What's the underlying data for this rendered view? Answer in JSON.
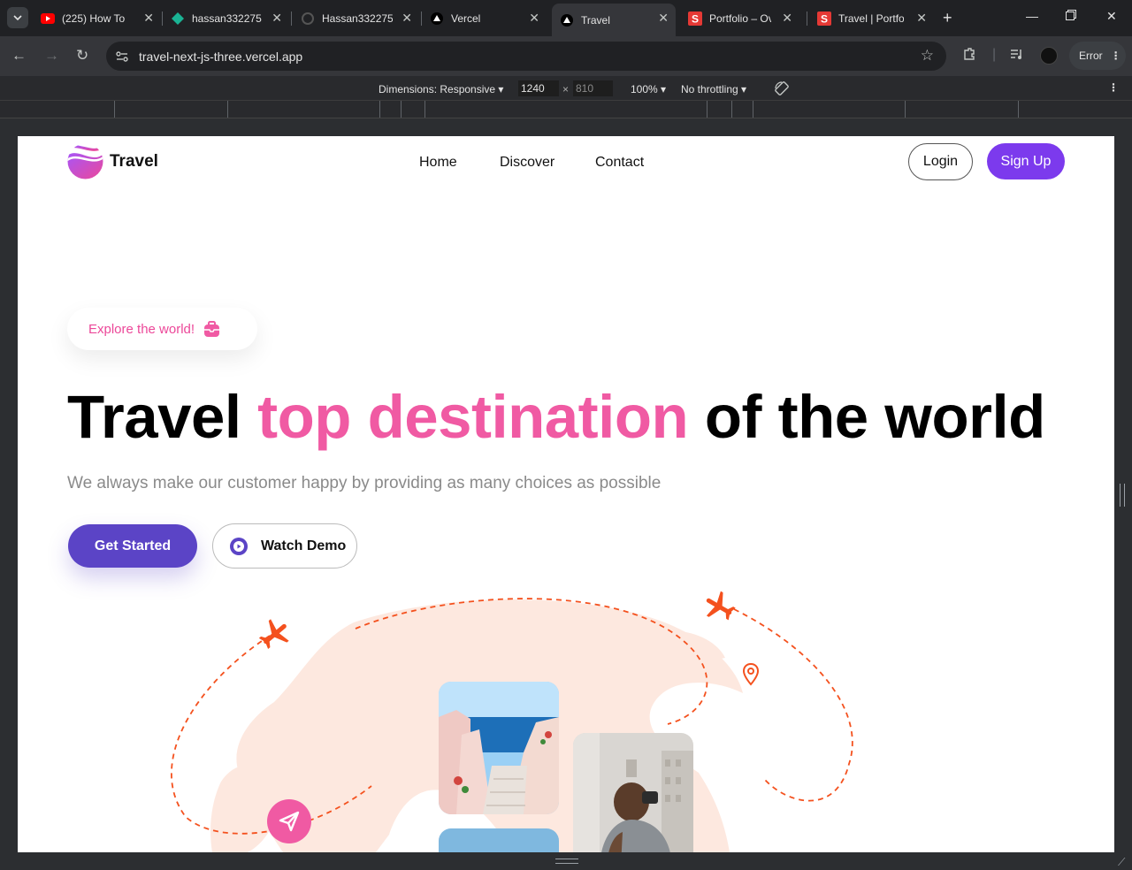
{
  "browser": {
    "tabs": [
      {
        "label": "(225) How To",
        "icon": "youtube-icon",
        "color": "#ff0000"
      },
      {
        "label": "hassan332275",
        "icon": "diamond-icon",
        "color": "#1ab394"
      },
      {
        "label": "Hassan332275",
        "icon": "github-icon",
        "color": "#555555"
      },
      {
        "label": "Vercel",
        "icon": "vercel-icon",
        "color": "#ffffff"
      },
      {
        "label": "Travel",
        "icon": "vercel-icon",
        "color": "#ffffff",
        "active": true
      },
      {
        "label": "Portfolio – Ov",
        "icon": "s-icon",
        "color": "#e53935"
      },
      {
        "label": "Travel | Portfo",
        "icon": "s-icon",
        "color": "#e53935"
      }
    ],
    "url": "travel-next-js-three.vercel.app",
    "profile_status": "Error",
    "devtools": {
      "dimensions_label": "Dimensions: Responsive",
      "width": "1240",
      "height": "810",
      "zoom": "100%",
      "throttling": "No throttling"
    }
  },
  "page": {
    "brand": "Travel",
    "nav": [
      "Home",
      "Discover",
      "Contact"
    ],
    "login_label": "Login",
    "signup_label": "Sign Up",
    "explore_label": "Explore the world!",
    "title_part1": "Travel",
    "title_highlight": "top destination",
    "title_part3": "of the world",
    "subtitle": "We always make our customer happy by providing as many choices as possible",
    "get_started_label": "Get Started",
    "watch_demo_label": "Watch Demo",
    "colors": {
      "accent_pink": "#f05aa3",
      "signup_purple": "#7c3aed",
      "cta_purple": "#5b44c6",
      "route_orange": "#f4511e",
      "map_tint": "#fde8df"
    }
  }
}
